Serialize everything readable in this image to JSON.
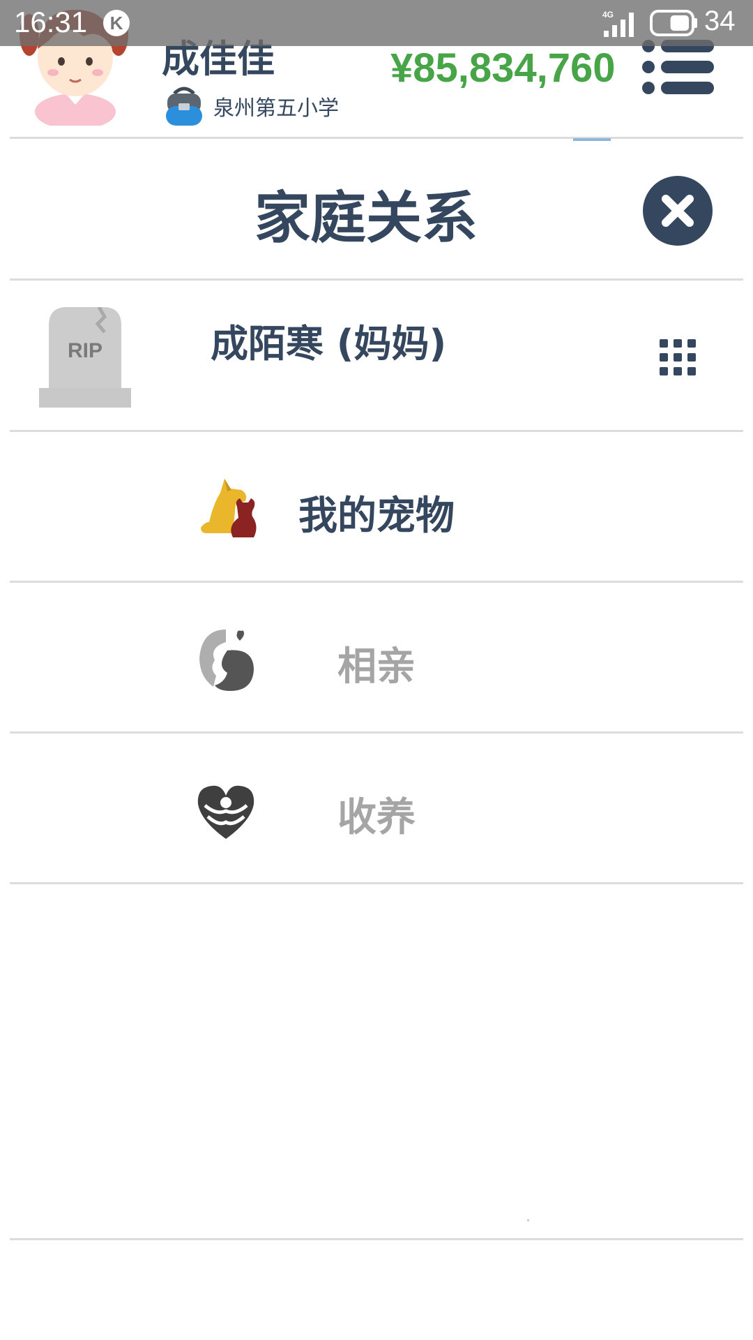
{
  "status_bar": {
    "time": "16:31",
    "app_badge": "K",
    "network": "4G",
    "battery_level": "34",
    "battery_fraction": 0.55
  },
  "header": {
    "player_name": "成佳佳",
    "school": "泉州第五小学",
    "money": "¥85,834,760",
    "money_color": "#47a447"
  },
  "dialog": {
    "title": "家庭关系",
    "relative": {
      "name": "成陌寒 (妈妈)",
      "tombstone_text": "RIP"
    },
    "options": [
      {
        "label": "我的宠物",
        "icon": "pet-icon",
        "enabled": true
      },
      {
        "label": "相亲",
        "icon": "matchmaking-icon",
        "enabled": false
      },
      {
        "label": "收养",
        "icon": "adopt-icon",
        "enabled": false
      }
    ]
  },
  "colors": {
    "text_primary": "#34475e",
    "text_disabled": "#a5a5a5",
    "divider": "#dcdcdc",
    "close_button": "#34475e"
  }
}
